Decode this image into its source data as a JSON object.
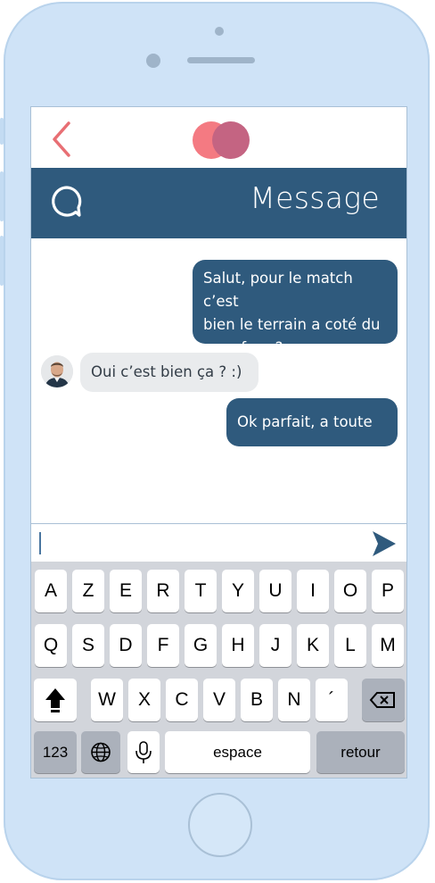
{
  "app": {
    "header_title": "Message",
    "colors": {
      "primary": "#2f5a7d",
      "logo_left": "#f47a82",
      "logo_right": "#c46482",
      "back_arrow": "#e86f74"
    }
  },
  "icons": {
    "back": "chevron-left-icon",
    "chat": "chat-bubble-icon",
    "send": "send-icon",
    "shift": "shift-icon",
    "backspace": "backspace-icon",
    "globe": "globe-icon",
    "mic": "microphone-icon"
  },
  "messages": [
    {
      "sender": "me",
      "lines": [
        "Salut, pour le match c’est",
        "bien le terrain a coté du",
        "carrefour ?"
      ]
    },
    {
      "sender": "other",
      "lines": [
        "Oui c’est bien ça ? :)"
      ]
    },
    {
      "sender": "me",
      "lines": [
        "Ok parfait, a toute !!"
      ]
    }
  ],
  "input": {
    "value": ""
  },
  "keyboard": {
    "row1": [
      "A",
      "Z",
      "E",
      "R",
      "T",
      "Y",
      "U",
      "I",
      "O",
      "P"
    ],
    "row2": [
      "Q",
      "S",
      "D",
      "F",
      "G",
      "H",
      "J",
      "K",
      "L",
      "M"
    ],
    "row3": [
      "W",
      "X",
      "C",
      "V",
      "B",
      "N",
      "´"
    ],
    "numbers_label": "123",
    "space_label": "espace",
    "return_label": "retour"
  }
}
